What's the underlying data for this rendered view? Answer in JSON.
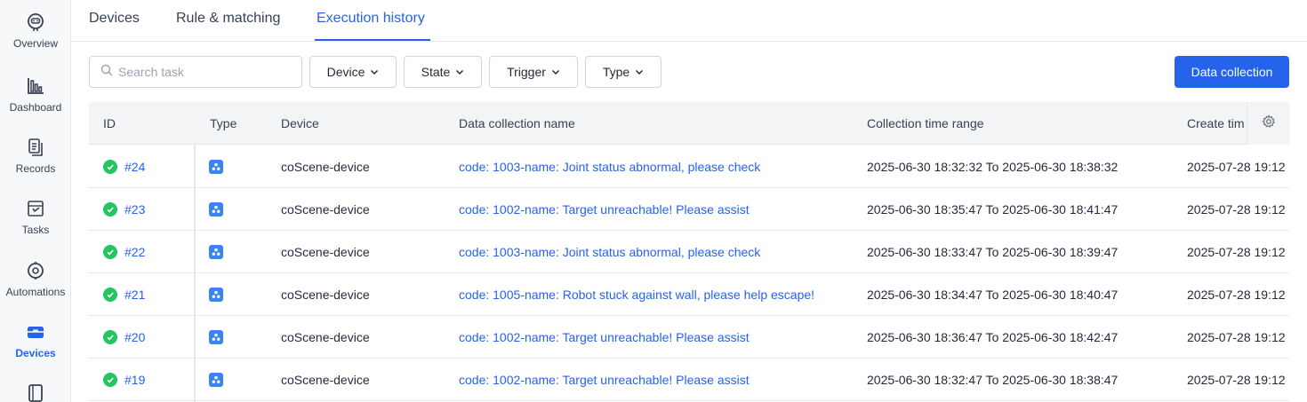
{
  "sidebar": {
    "items": [
      {
        "label": "Overview",
        "icon": "robot-face-icon"
      },
      {
        "label": "Dashboard",
        "icon": "bar-chart-icon"
      },
      {
        "label": "Records",
        "icon": "documents-icon"
      },
      {
        "label": "Tasks",
        "icon": "task-flag-icon"
      },
      {
        "label": "Automations",
        "icon": "automation-gear-icon"
      },
      {
        "label": "Devices",
        "icon": "device-box-icon",
        "active": true
      },
      {
        "label": "",
        "icon": "book-icon"
      }
    ],
    "active_color": "#2563eb"
  },
  "tabs": [
    {
      "label": "Devices"
    },
    {
      "label": "Rule & matching"
    },
    {
      "label": "Execution history",
      "active": true
    }
  ],
  "toolbar": {
    "search_placeholder": "Search task",
    "filters": [
      "Device",
      "State",
      "Trigger",
      "Type"
    ],
    "primary_button": "Data collection"
  },
  "table": {
    "columns": [
      "ID",
      "Type",
      "Device",
      "Data collection name",
      "Collection time range",
      "Create tim"
    ],
    "rows": [
      {
        "id": "#24",
        "device": "coScene-device",
        "name": "code: 1003-name: Joint status abnormal, please check",
        "range": "2025-06-30 18:32:32 To 2025-06-30 18:38:32",
        "created": "2025-07-28 19:12"
      },
      {
        "id": "#23",
        "device": "coScene-device",
        "name": "code: 1002-name: Target unreachable! Please assist",
        "range": "2025-06-30 18:35:47 To 2025-06-30 18:41:47",
        "created": "2025-07-28 19:12"
      },
      {
        "id": "#22",
        "device": "coScene-device",
        "name": "code: 1003-name: Joint status abnormal, please check",
        "range": "2025-06-30 18:33:47 To 2025-06-30 18:39:47",
        "created": "2025-07-28 19:12"
      },
      {
        "id": "#21",
        "device": "coScene-device",
        "name": "code: 1005-name: Robot stuck against wall, please help escape!",
        "range": "2025-06-30 18:34:47 To 2025-06-30 18:40:47",
        "created": "2025-07-28 19:12"
      },
      {
        "id": "#20",
        "device": "coScene-device",
        "name": "code: 1002-name: Target unreachable! Please assist",
        "range": "2025-06-30 18:36:47 To 2025-06-30 18:42:47",
        "created": "2025-07-28 19:12"
      },
      {
        "id": "#19",
        "device": "coScene-device",
        "name": "code: 1002-name: Target unreachable! Please assist",
        "range": "2025-06-30 18:32:47 To 2025-06-30 18:38:47",
        "created": "2025-07-28 19:12"
      }
    ],
    "status_color": "#22c55e",
    "type_icon": "device-group-icon",
    "settings_icon": "gear-icon"
  }
}
